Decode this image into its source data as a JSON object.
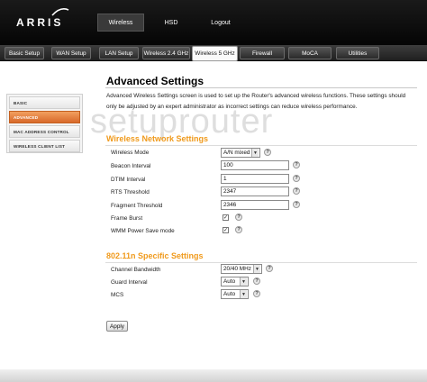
{
  "brand": {
    "logo_text": "ARRIS"
  },
  "top_nav": {
    "tabs": [
      {
        "label": "Wireless",
        "active": true
      },
      {
        "label": "HSD",
        "active": false
      },
      {
        "label": "Logout",
        "active": false
      }
    ]
  },
  "sub_nav": {
    "tabs": [
      {
        "label": "Basic Setup",
        "active": false
      },
      {
        "label": "WAN Setup",
        "active": false
      },
      {
        "label": "LAN Setup",
        "active": false
      },
      {
        "label": "Wireless 2.4 GHz",
        "active": false
      },
      {
        "label": "Wireless 5 GHz",
        "active": true
      },
      {
        "label": "Firewall",
        "active": false
      },
      {
        "label": "MoCA",
        "active": false
      },
      {
        "label": "Utilities",
        "active": false
      }
    ]
  },
  "watermark": "setuprouter",
  "left_menu": {
    "items": [
      {
        "label": "BASIC",
        "active": false
      },
      {
        "label": "ADVANCED",
        "active": true
      },
      {
        "label": "MAC ADDRESS CONTROL",
        "active": false
      },
      {
        "label": "WIRELESS CLIENT LIST",
        "active": false
      }
    ]
  },
  "page": {
    "title": "Advanced Settings",
    "description": "Advanced Wireless Settings screen is used to set up the Router's advanced wireless functions. These settings should only be adjusted by an expert administrator as incorrect settings can reduce wireless performance."
  },
  "wireless_network": {
    "title": "Wireless Network Settings",
    "wireless_mode": {
      "label": "Wireless Mode",
      "value": "A/N mixed"
    },
    "beacon_interval": {
      "label": "Beacon Interval",
      "value": "100"
    },
    "dtim_interval": {
      "label": "DTIM Interval",
      "value": "1"
    },
    "rts_threshold": {
      "label": "RTS Threshold",
      "value": "2347"
    },
    "fragment_threshold": {
      "label": "Fragment Threshold",
      "value": "2346"
    },
    "frame_burst": {
      "label": "Frame Burst",
      "checked": true
    },
    "wmm_power_save": {
      "label": "WMM Power Save mode",
      "checked": true
    }
  },
  "n_specific": {
    "title": "802.11n Specific Settings",
    "channel_bandwidth": {
      "label": "Channel Bandwidth",
      "value": "20/40 MHz"
    },
    "guard_interval": {
      "label": "Guard Interval",
      "value": "Auto"
    },
    "mcs": {
      "label": "MCS",
      "value": "Auto"
    }
  },
  "help_glyph": "?",
  "check_glyph": "✓",
  "arrow_glyph": "▼",
  "apply_label": "Apply",
  "colors": {
    "accent_orange": "#f09a1c",
    "menu_active": "#d8692a",
    "header_bg": "#0d0d0d"
  }
}
